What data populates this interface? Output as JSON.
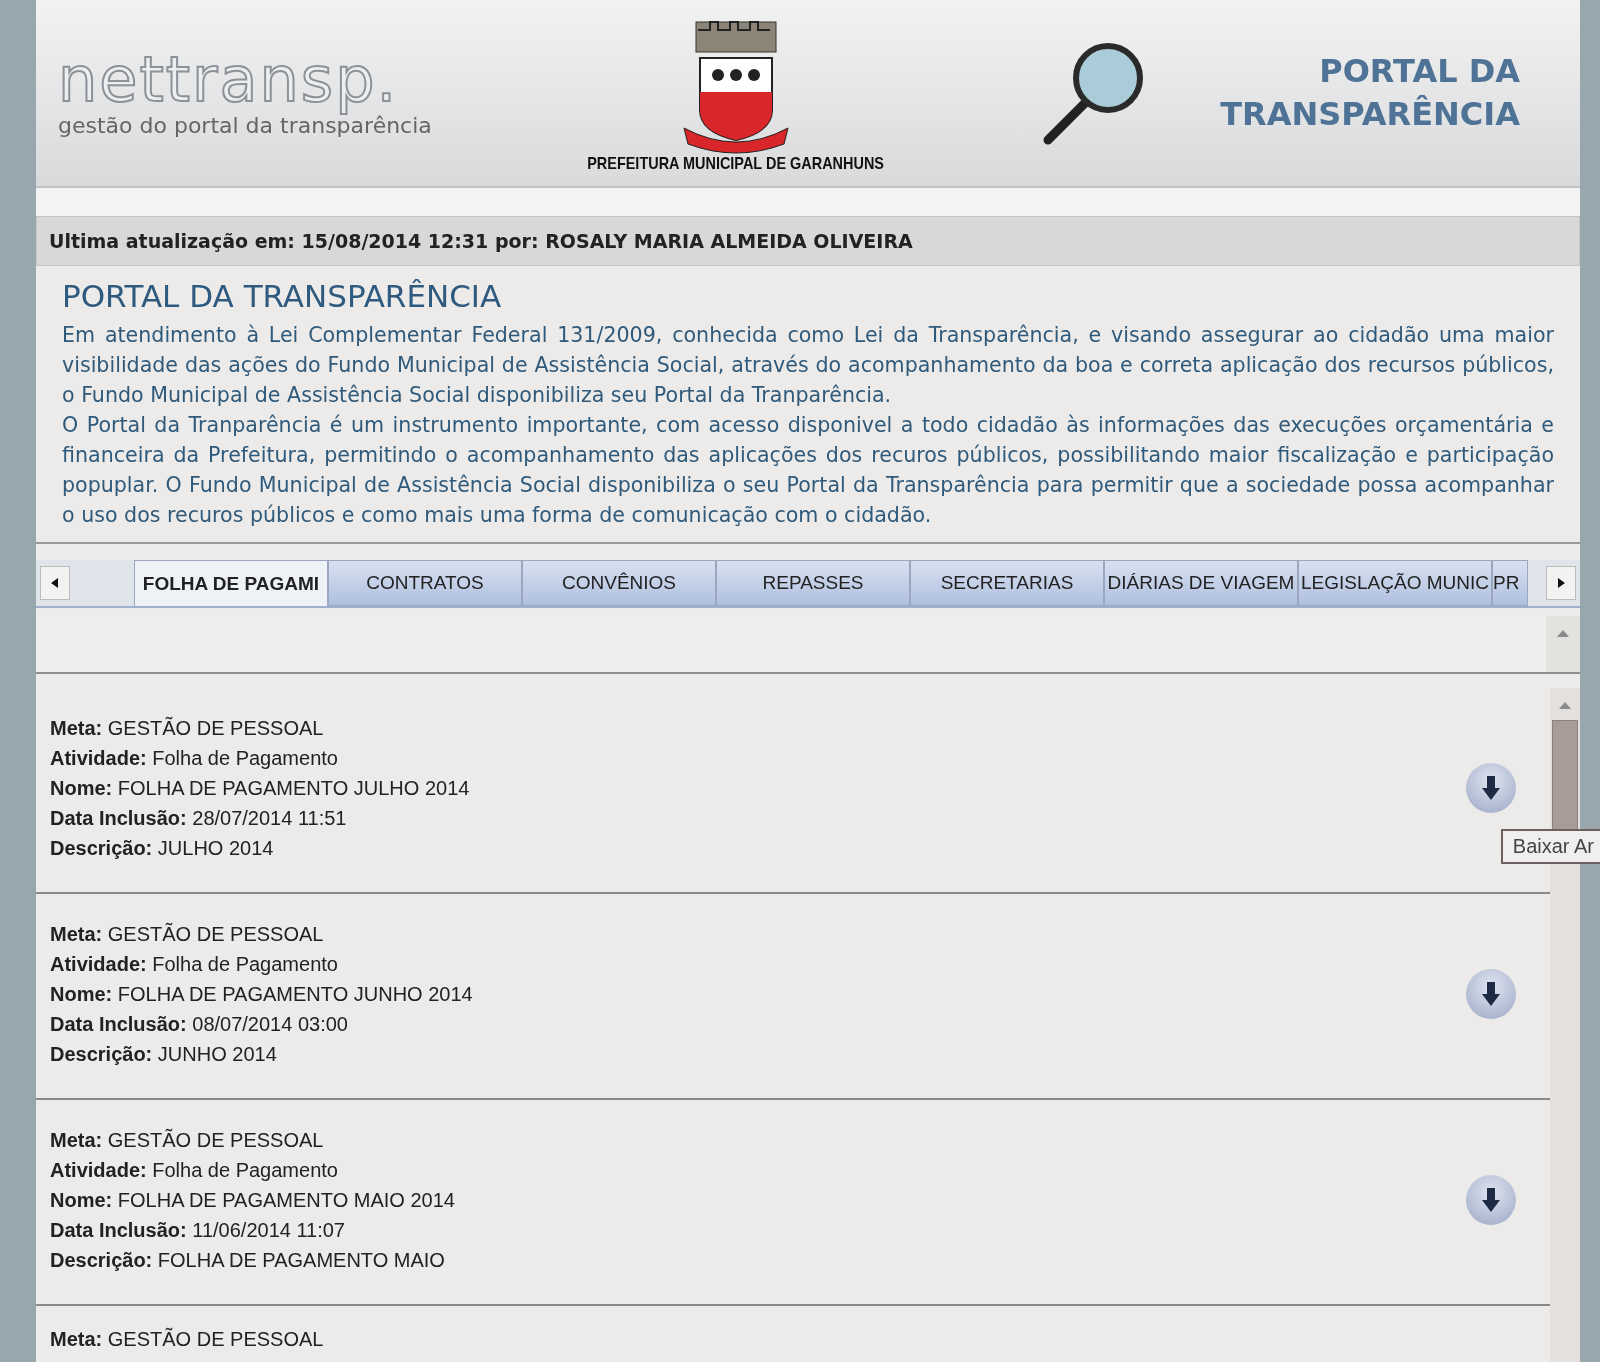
{
  "header": {
    "logo": "nettransp.",
    "logo_subtitle": "gestão do portal da transparência",
    "city": "PREFEITURA MUNICIPAL DE GARANHUNS",
    "portal_title": "PORTAL DA TRANSPARÊNCIA"
  },
  "update_bar": "Ultima atualização em: 15/08/2014 12:31 por: ROSALY MARIA ALMEIDA OLIVEIRA",
  "intro": {
    "title": "PORTAL DA TRANSPARÊNCIA",
    "paragraphs": [
      "Em atendimento à Lei Complementar Federal 131/2009, conhecida como Lei da Transparência, e visando assegurar ao cidadão uma maior visibilidade das ações do Fundo Municipal de Assistência Social, através do acompanhamento da boa e correta aplicação dos recursos públicos, o Fundo Municipal de Assistência Social disponibiliza seu Portal da Tranparência.",
      "O Portal da Tranparência é um instrumento importante, com acesso disponivel a todo cidadão às informações das execuções orçamentária e financeira da Prefeitura, permitindo o acompanhamento das aplicações dos recuros públicos, possibilitando maior fiscalização e participação popuplar. O Fundo Municipal de Assistência Social disponibiliza o seu Portal da Transparência para permitir que a sociedade possa acompanhar o uso dos recuros públicos e como mais uma forma de comunicação com o cidadão."
    ]
  },
  "tabs": [
    {
      "label": "FOLHA DE PAGAMI",
      "selected": true
    },
    {
      "label": "CONTRATOS",
      "selected": false
    },
    {
      "label": "CONVÊNIOS",
      "selected": false
    },
    {
      "label": "REPASSES",
      "selected": false
    },
    {
      "label": "SECRETARIAS",
      "selected": false
    },
    {
      "label": "DIÁRIAS DE VIAGEM",
      "selected": false
    },
    {
      "label": "LEGISLAÇÃO MUNIC",
      "selected": false
    },
    {
      "label": "PR",
      "selected": false
    }
  ],
  "records": [
    {
      "fields": [
        "**Meta:** GESTÃO DE PESSOAL",
        "**Atividade:** Folha de Pagamento",
        "**Nome:** FOLHA DE PAGAMENTO JULHO 2014",
        "**Data Inclusão:** 28/07/2014 11:51",
        "**Descrição:** JULHO 2014"
      ],
      "tooltip": "Baixar Ar"
    },
    {
      "fields": [
        "**Meta:** GESTÃO DE PESSOAL",
        "**Atividade:** Folha de Pagamento",
        "**Nome:** FOLHA DE PAGAMENTO JUNHO 2014",
        "**Data Inclusão:** 08/07/2014 03:00",
        "**Descrição:** JUNHO 2014"
      ]
    },
    {
      "fields": [
        "**Meta:** GESTÃO DE PESSOAL",
        "**Atividade:** Folha de Pagamento",
        "**Nome:** FOLHA DE PAGAMENTO MAIO 2014",
        "**Data Inclusão:** 11/06/2014 11:07",
        "**Descrição:** FOLHA DE PAGAMENTO MAIO"
      ]
    },
    {
      "fields": [
        "**Meta:** GESTÃO DE PESSOAL"
      ]
    }
  ]
}
